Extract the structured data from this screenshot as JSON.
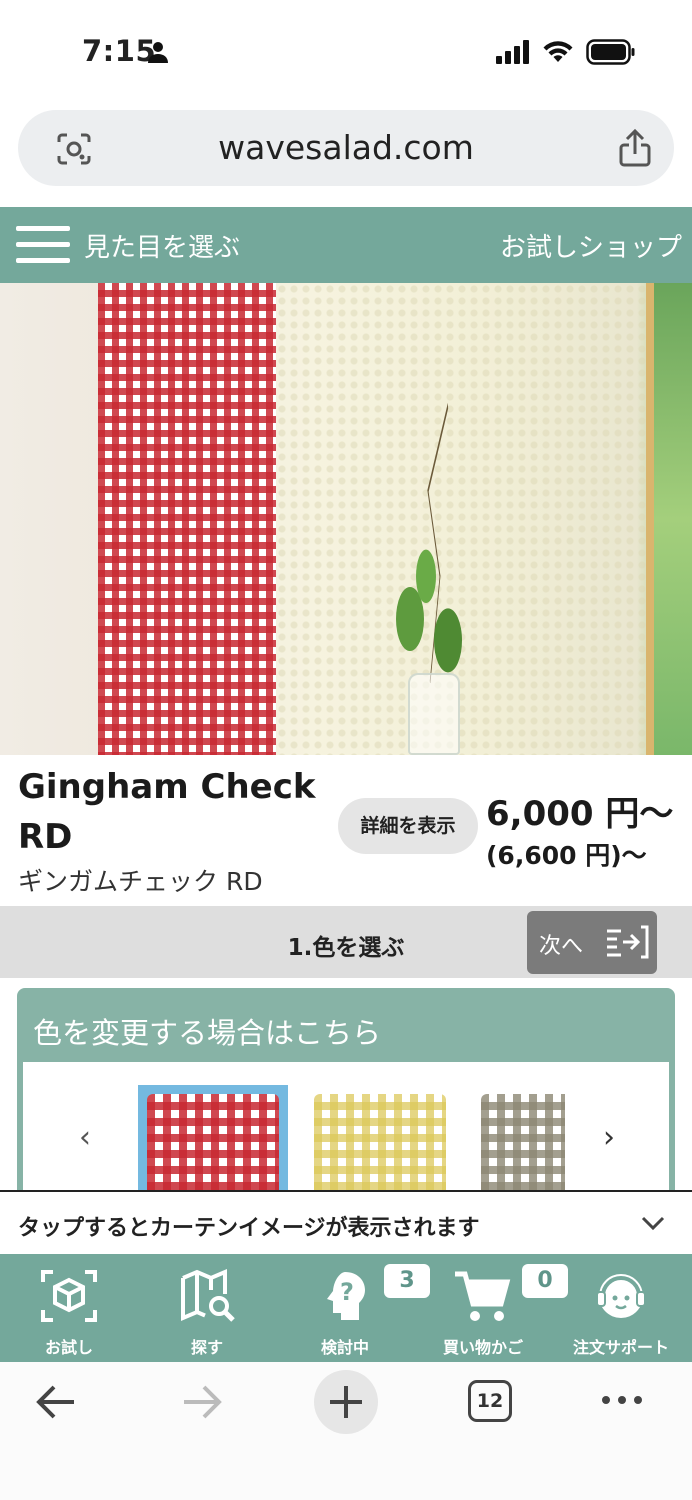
{
  "status_bar": {
    "time": "7:15"
  },
  "browser": {
    "url": "wavesalad.com",
    "tab_count": "12"
  },
  "header": {
    "menu_label": "見た目を選ぶ",
    "shop_label": "お試しショップ"
  },
  "product": {
    "name": "Gingham Check RD",
    "subname": "ギンガムチェック RD",
    "detail_button": "詳細を表示",
    "price": "6,000 円〜",
    "price_with_tax": "(6,600 円)〜"
  },
  "step": {
    "title": "1.色を選ぶ",
    "next_label": "次へ"
  },
  "color_panel": {
    "title": "色を変更する場合はこちら",
    "prev_arrow": "‹",
    "next_arrow": "›",
    "swatches": [
      "red-gingham",
      "yellow-gingham",
      "gray-gingham"
    ]
  },
  "tap_banner": {
    "text": "タップするとカーテンイメージが表示されます"
  },
  "bottom_nav": {
    "items": [
      {
        "label": "お試し",
        "icon": "cube-icon"
      },
      {
        "label": "探す",
        "icon": "map-search-icon"
      },
      {
        "label": "検討中",
        "icon": "question-head-icon",
        "badge": "3"
      },
      {
        "label": "買い物かご",
        "icon": "cart-icon",
        "badge": "0"
      },
      {
        "label": "注文サポート",
        "icon": "support-icon"
      }
    ]
  },
  "colors": {
    "header_bg": "#74a89b",
    "panel_bg": "#87b3a6",
    "selected_swatch": "#74b9e0"
  }
}
